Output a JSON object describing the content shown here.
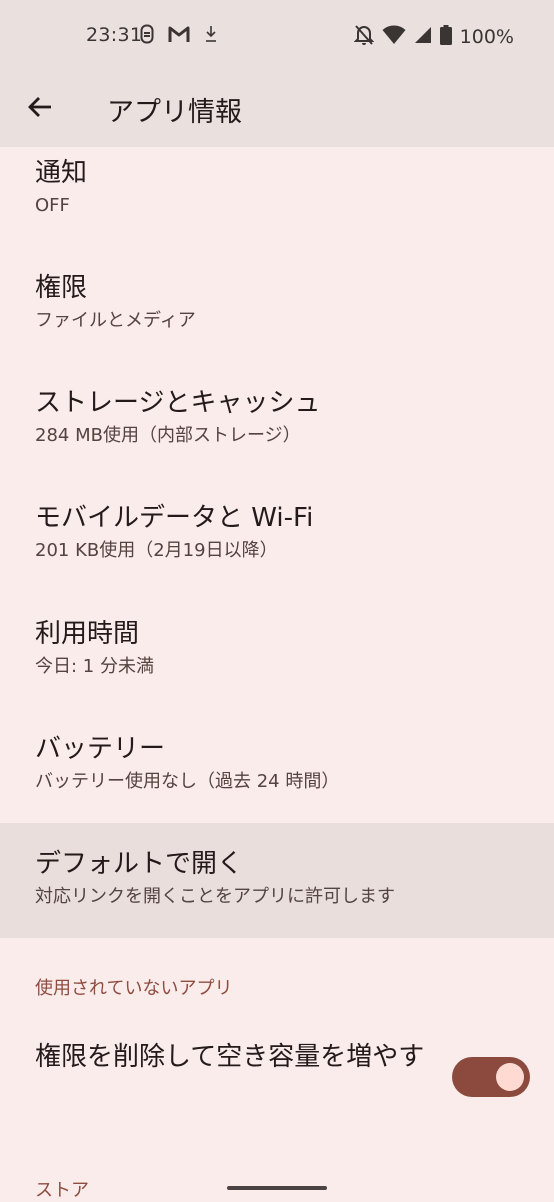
{
  "status_bar": {
    "time": "23:31",
    "battery": "100%",
    "icons_left": [
      "keyboard-app-icon",
      "gmail-icon",
      "download-icon"
    ],
    "icons_right": [
      "notifications-off-icon",
      "wifi-icon",
      "signal-icon",
      "battery-icon"
    ]
  },
  "app_bar": {
    "title": "アプリ情報"
  },
  "prefs": [
    {
      "title": "通知",
      "summary": "OFF"
    },
    {
      "title": "権限",
      "summary": "ファイルとメディア"
    },
    {
      "title": "ストレージとキャッシュ",
      "summary": "284 MB使用（内部ストレージ）"
    },
    {
      "title": "モバイルデータと Wi-Fi",
      "summary": "201 KB使用（2月19日以降）"
    },
    {
      "title": "利用時間",
      "summary": "今日: 1 分未満"
    },
    {
      "title": "バッテリー",
      "summary": "バッテリー使用なし（過去 24 時間）"
    },
    {
      "title": "デフォルトで開く",
      "summary": "対応リンクを開くことをアプリに許可します"
    }
  ],
  "unused_apps": {
    "header": "使用されていないアプリ",
    "toggle_title": "権限を削除して空き容量を増やす",
    "toggle_on": true
  },
  "store": {
    "header": "ストア"
  },
  "colors": {
    "background": "#F9ECEA",
    "app_bar": "#EAE0DE",
    "accent": "#8F4C40",
    "toggle_track": "#8C4A3F",
    "toggle_thumb": "#FFDAD3"
  }
}
